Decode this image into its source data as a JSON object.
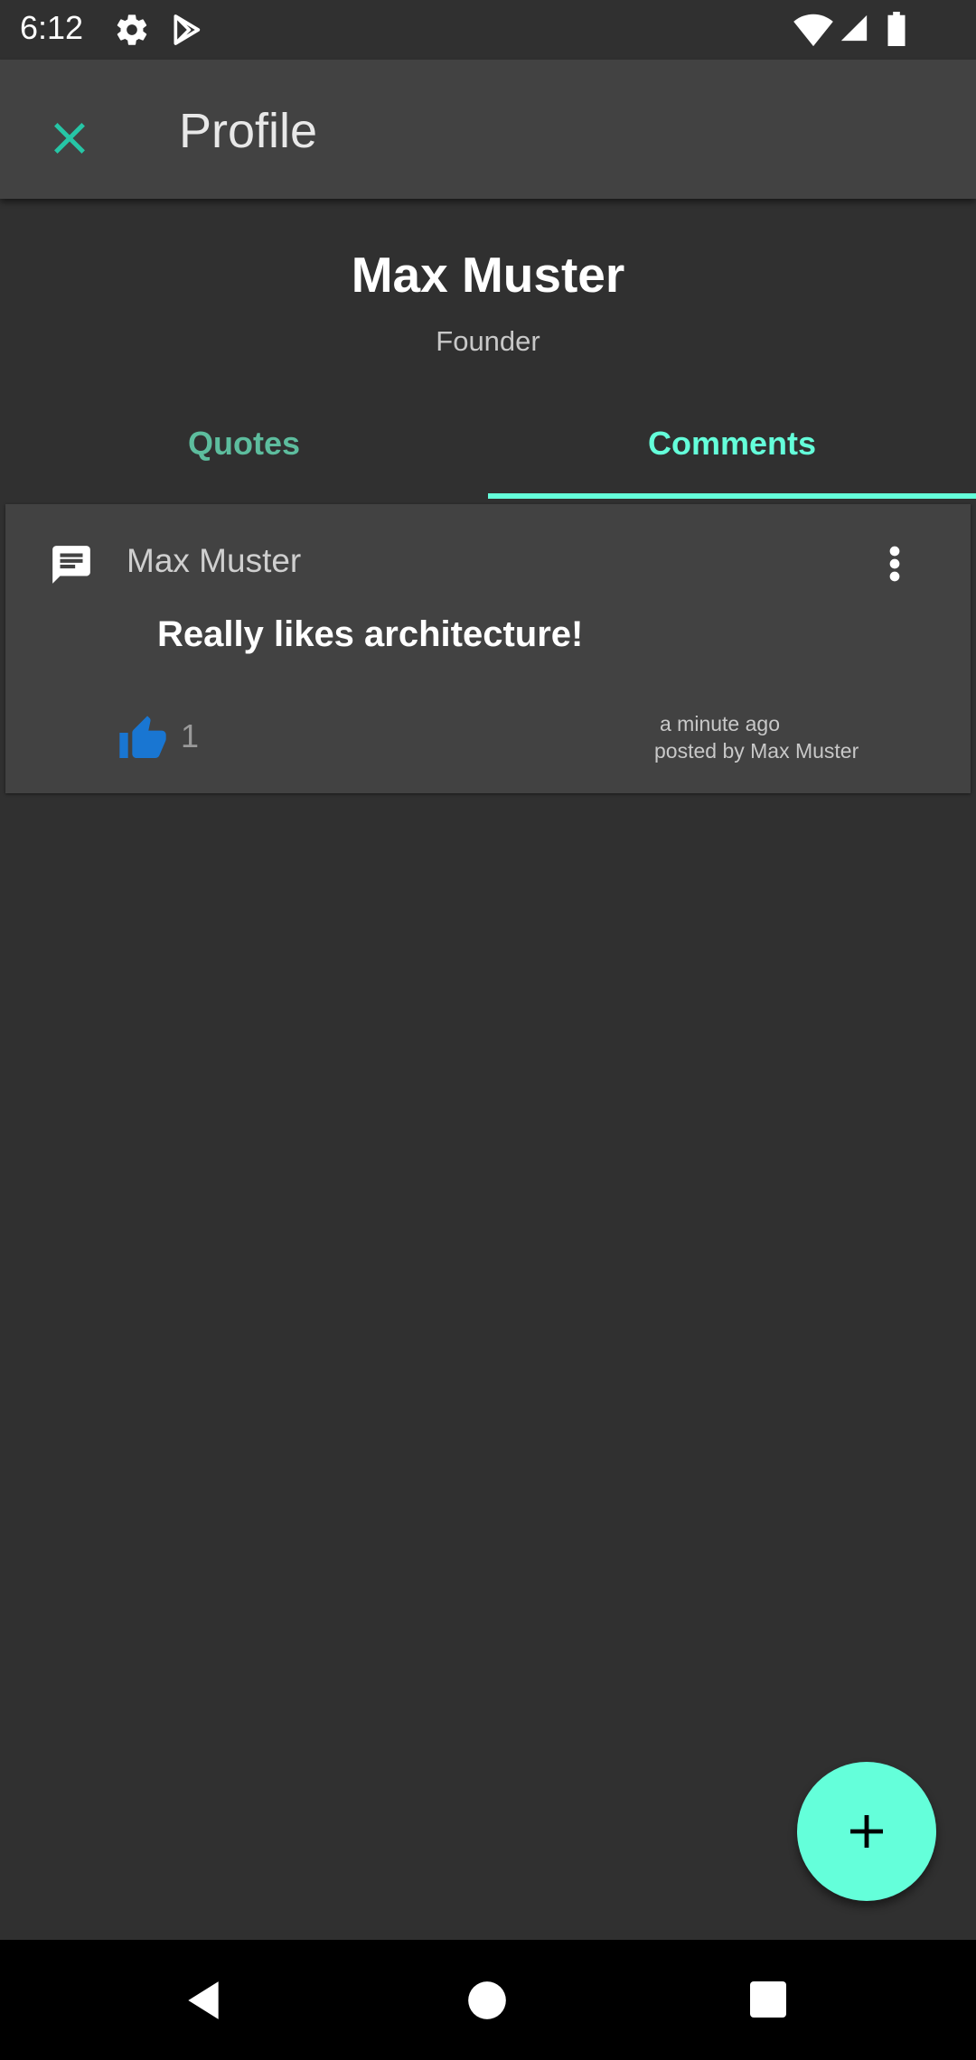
{
  "status_bar": {
    "time": "6:12",
    "icons": [
      "settings-icon",
      "play-store-icon",
      "wifi-icon",
      "signal-icon",
      "battery-icon"
    ]
  },
  "app_bar": {
    "title": "Profile",
    "close_icon": "close-icon"
  },
  "profile": {
    "name": "Max Muster",
    "role": "Founder"
  },
  "tabs": [
    {
      "label": "Quotes",
      "selected": false
    },
    {
      "label": "Comments",
      "selected": true
    }
  ],
  "comments": [
    {
      "icon": "comment-icon",
      "author": "Max Muster",
      "text": "Really likes architecture!",
      "likes": "1",
      "time": "a minute ago",
      "posted_by": "posted by Max Muster"
    }
  ],
  "fab": {
    "icon": "plus-icon"
  },
  "nav_bar": {
    "icons": [
      "back-icon",
      "home-icon",
      "recents-icon"
    ]
  },
  "colors": {
    "accent": "#64ffda",
    "accent_dim": "#5dbd9e",
    "close_icon": "#26c6a6",
    "background": "#303030",
    "surface": "#424242",
    "like_blue": "#1976d2"
  }
}
